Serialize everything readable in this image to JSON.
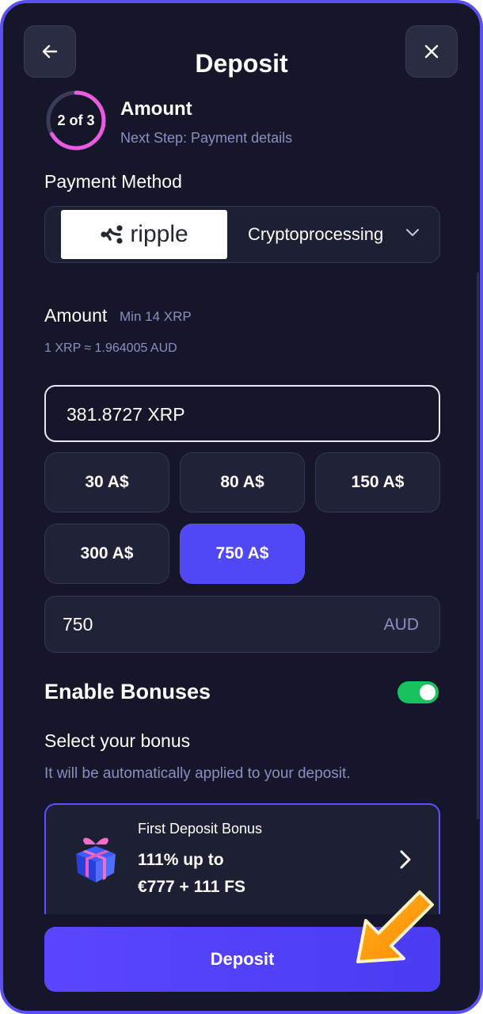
{
  "header": {
    "title": "Deposit"
  },
  "step": {
    "counter": "2 of 3",
    "title": "Amount",
    "next": "Next Step: Payment details",
    "progress": 0.667
  },
  "payment": {
    "label": "Payment Method",
    "logo_text": "ripple",
    "method": "Cryptoprocessing"
  },
  "amount": {
    "label": "Amount",
    "min": "Min 14 XRP",
    "rate": "1 XRP ≈ 1.964005 AUD",
    "value": "381.8727 XRP"
  },
  "presets": [
    "30 A$",
    "80 A$",
    "150 A$",
    "300 A$",
    "750 A$"
  ],
  "selected_preset": "750 A$",
  "fiat": {
    "value": "750",
    "currency": "AUD"
  },
  "bonuses": {
    "title": "Enable Bonuses",
    "enabled": true,
    "select_title": "Select your bonus",
    "select_sub": "It will be automatically applied to your deposit.",
    "card": {
      "name": "First Deposit Bonus",
      "line1": "111% up to",
      "line2": "€777 + 111 FS",
      "icon": "gift-icon"
    }
  },
  "deposit_button": "Deposit",
  "colors": {
    "accent": "#5047f5",
    "background": "#15162a",
    "toggle_on": "#17c25f",
    "step_ring": "#e95ce0"
  }
}
